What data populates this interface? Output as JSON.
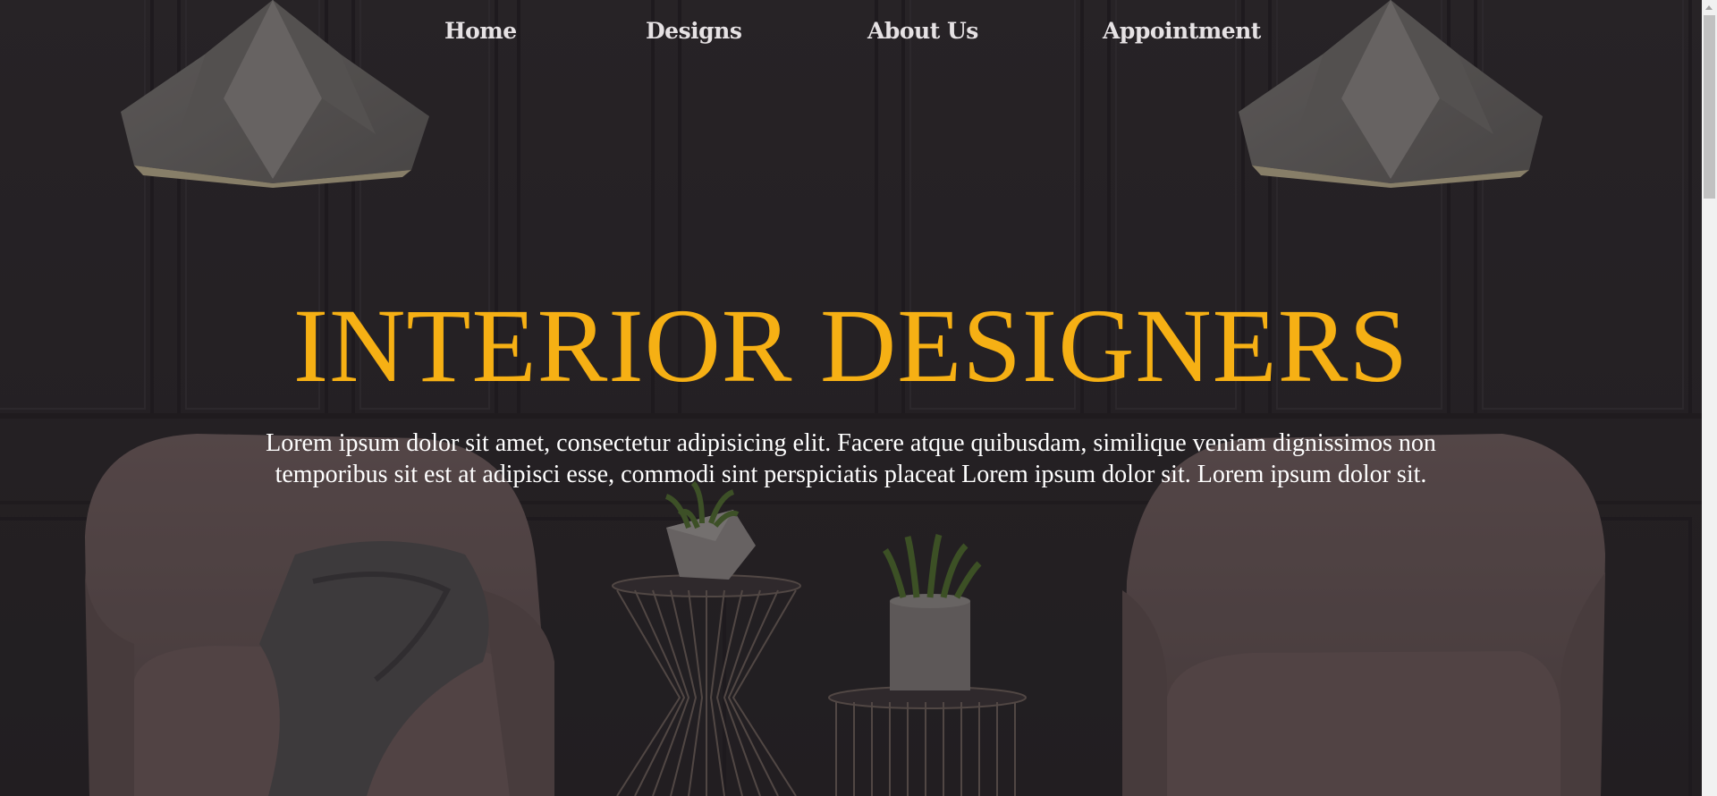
{
  "nav": {
    "items": [
      {
        "label": "Home"
      },
      {
        "label": "Designs"
      },
      {
        "label": "About Us"
      },
      {
        "label": "Appointment"
      }
    ]
  },
  "hero": {
    "title": "INTERIOR DESIGNERS",
    "text": "Lorem ipsum dolor sit amet, consectetur adipisicing elit. Facere atque quibusdam, similique veniam dignissimos non temporibus sit est at adipisci esse, commodi sint perspiciatis placeat Lorem ipsum dolor sit. Lorem ipsum dolor sit."
  },
  "colors": {
    "accent": "#f6b014",
    "nav_text": "#e6e2e4",
    "background": "#2b2729"
  }
}
